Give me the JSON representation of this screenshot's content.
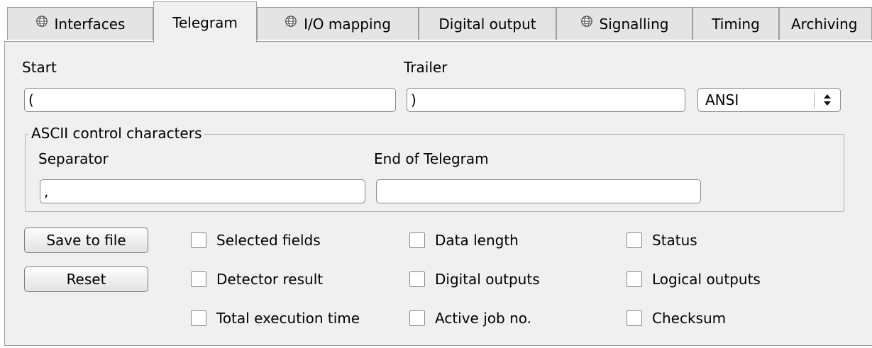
{
  "tabs": [
    {
      "label": "Interfaces",
      "icon": "globe-icon"
    },
    {
      "label": "Telegram",
      "icon": null
    },
    {
      "label": "I/O mapping",
      "icon": "globe-icon"
    },
    {
      "label": "Digital output",
      "icon": null
    },
    {
      "label": "Signalling",
      "icon": "globe-icon"
    },
    {
      "label": "Timing",
      "icon": null
    },
    {
      "label": "Archiving",
      "icon": null
    }
  ],
  "active_tab": "Telegram",
  "start": {
    "label": "Start",
    "value": "("
  },
  "trailer": {
    "label": "Trailer",
    "value": ")"
  },
  "encoding": {
    "selected": "ANSI"
  },
  "control_chars": {
    "title": "ASCII control characters",
    "separator": {
      "label": "Separator",
      "value": ","
    },
    "end_of_telegram": {
      "label": "End of Telegram",
      "value": ""
    }
  },
  "buttons": {
    "save": "Save to file",
    "reset": "Reset"
  },
  "checkboxes": {
    "selected_fields": "Selected fields",
    "detector_result": "Detector result",
    "total_execution_time": "Total execution time",
    "data_length": "Data length",
    "digital_outputs": "Digital outputs",
    "active_job_no": "Active job no.",
    "status": "Status",
    "logical_outputs": "Logical outputs",
    "checksum": "Checksum"
  },
  "colors": {
    "panel": "#f0f0f0",
    "tab_inactive": "#e4e4e4",
    "border": "#9c9c9c"
  }
}
